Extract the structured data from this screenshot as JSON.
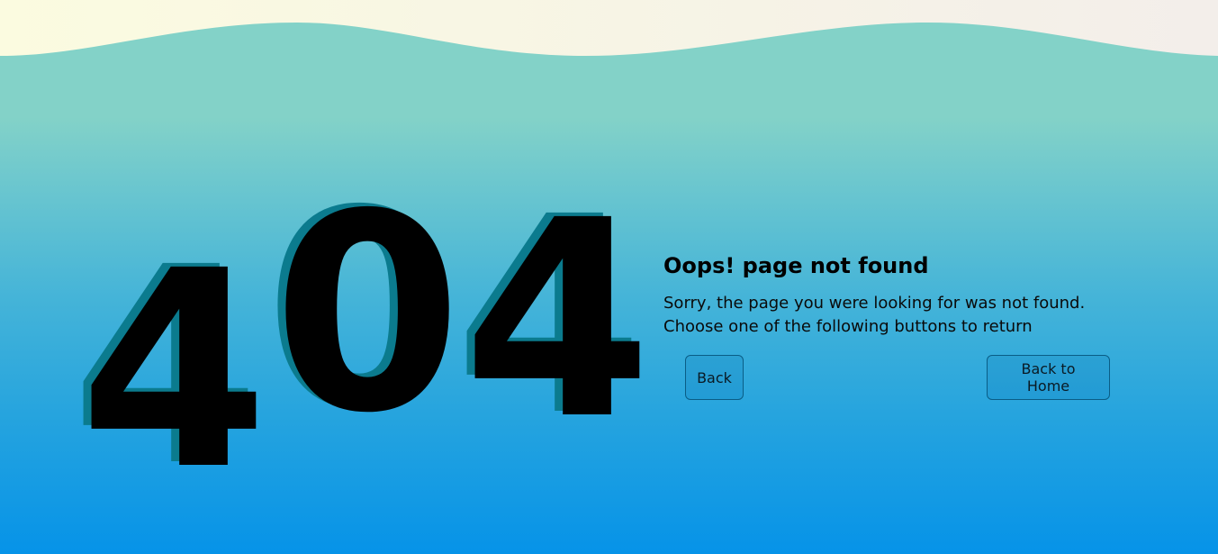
{
  "error": {
    "digits": [
      "4",
      "0",
      "4"
    ]
  },
  "message": {
    "title": "Oops! page not found",
    "line1": "Sorry, the page you were looking for was not found.",
    "line2": "Choose one of the following buttons to return"
  },
  "buttons": {
    "back": "Back",
    "home": "Back to Home"
  },
  "colors": {
    "wave": "#f7f6e4",
    "top_teal": "#83d2c8",
    "bottom_blue": "#0693e8",
    "digit": "#000000",
    "digit_shadow": "#0b7b8e"
  }
}
